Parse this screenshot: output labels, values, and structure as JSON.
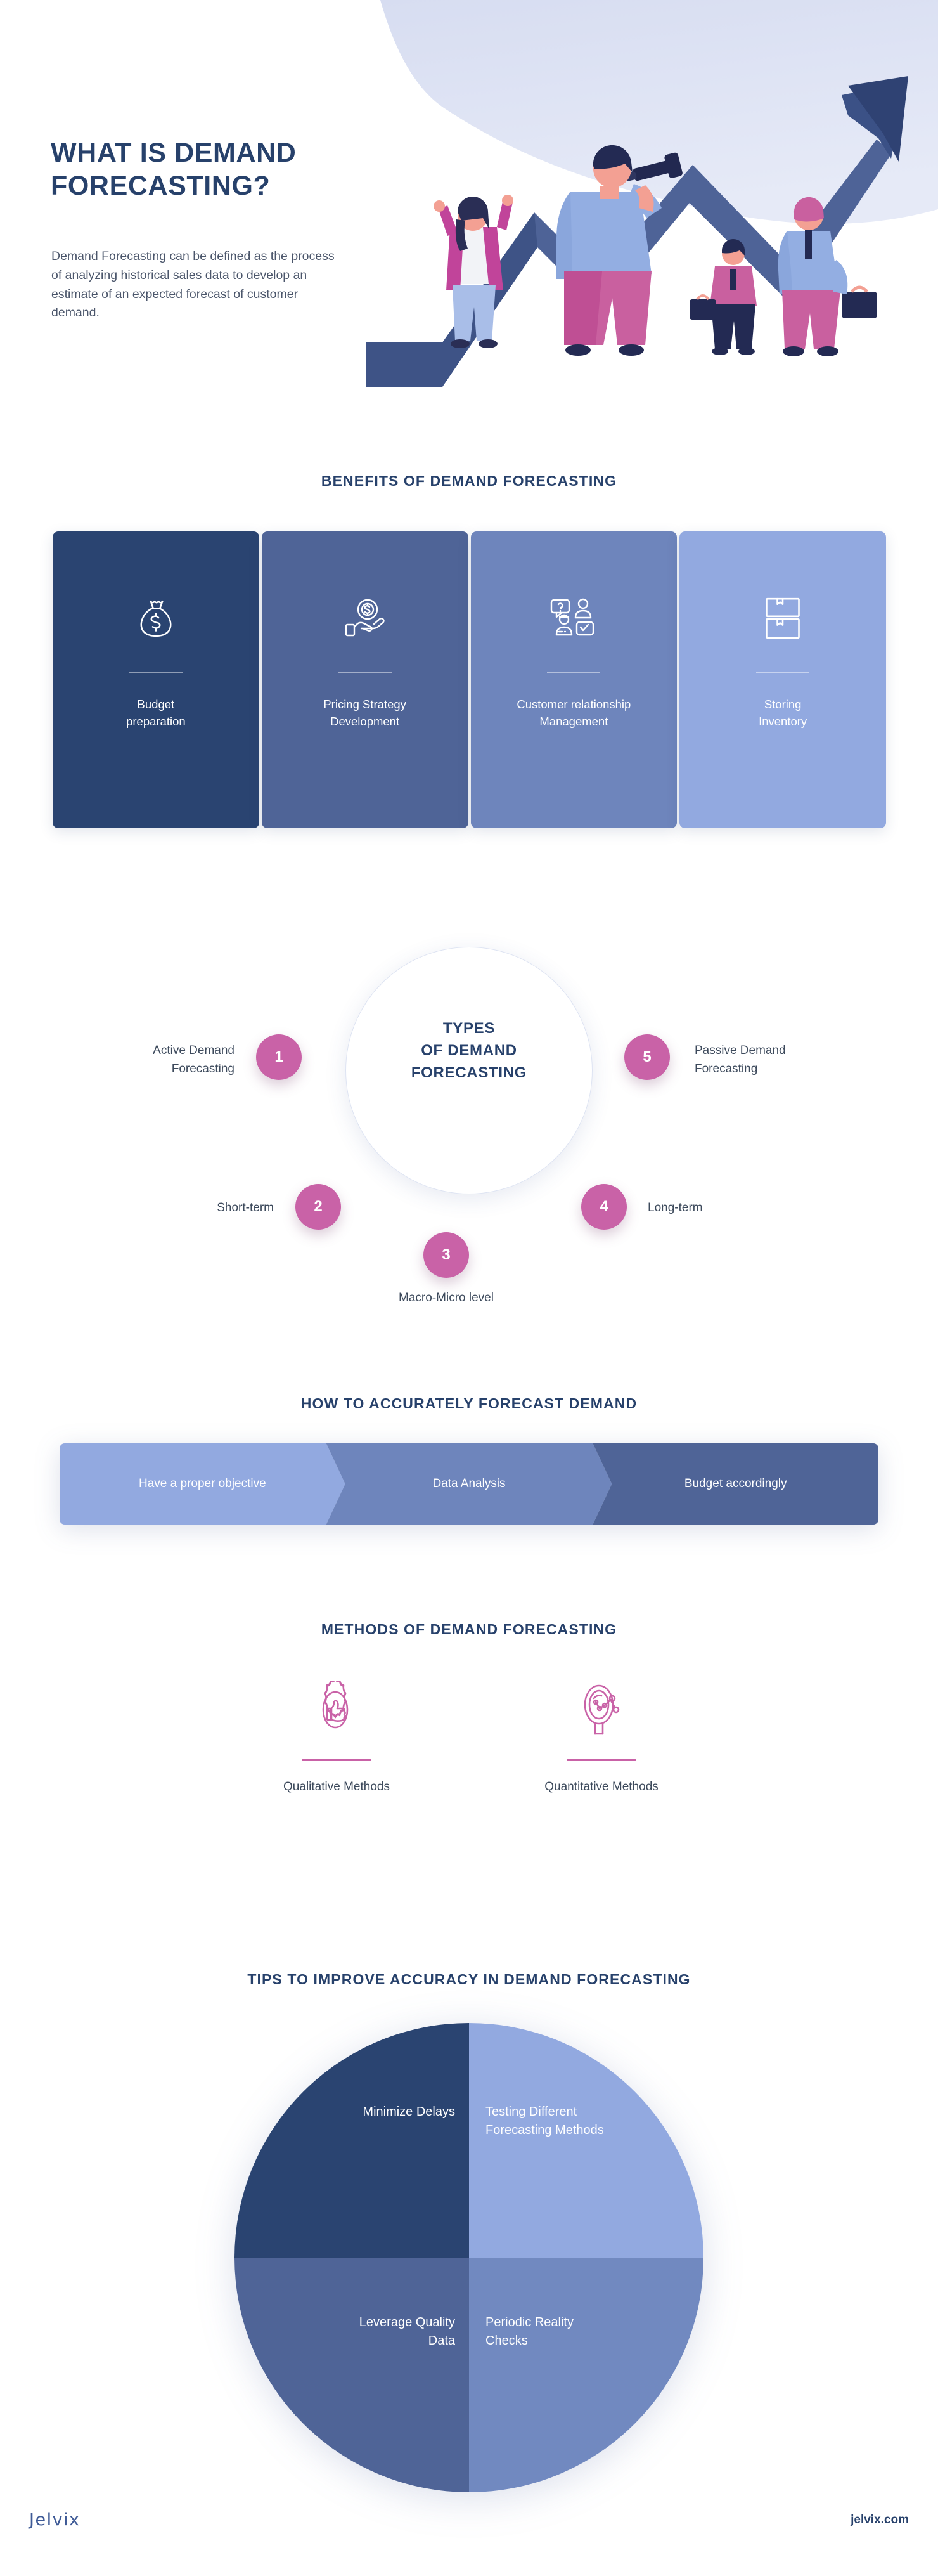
{
  "colors": {
    "navy": "#27416B",
    "navy_dark": "#2A4471",
    "slate": "#4F6497",
    "blue_mid": "#6E85BC",
    "blue_light": "#92A9E0",
    "pink": "#C962A7",
    "body_text": "#4B566B",
    "wave": "#DBE0F2"
  },
  "hero": {
    "title": "What is Demand Forecasting?",
    "description": "Demand Forecasting can be defined as the process of analyzing historical sales data to develop an estimate of an expected forecast of customer demand.",
    "illustration": "business-people-growth-arrow-telescope-illustration"
  },
  "benefits": {
    "heading": "Benefits of Demand Forecasting",
    "cards": [
      {
        "label": "Budget\npreparation",
        "icon": "money-bag-icon",
        "color": "#2A4471"
      },
      {
        "label": "Pricing Strategy\nDevelopment",
        "icon": "hand-holding-coin-icon",
        "color": "#4F6497"
      },
      {
        "label": "Customer relationship\nManagement",
        "icon": "customer-support-people-icon",
        "color": "#6E85BC"
      },
      {
        "label": "Storing\nInventory",
        "icon": "inventory-box-icon",
        "color": "#92A9E0"
      }
    ]
  },
  "types": {
    "center_title": "Types\nof Demand\nForecasting",
    "nodes": [
      {
        "number": "1",
        "label": "Active Demand\nForecasting"
      },
      {
        "number": "2",
        "label": "Short-term"
      },
      {
        "number": "3",
        "label": "Macro-Micro level"
      },
      {
        "number": "4",
        "label": "Long-term"
      },
      {
        "number": "5",
        "label": "Passive Demand\nForecasting"
      }
    ]
  },
  "process": {
    "heading": "How to Accurately Forecast Demand",
    "steps": [
      {
        "label": "Have a proper objective",
        "color": "#92A9E0"
      },
      {
        "label": "Data Analysis",
        "color": "#6E85BC"
      },
      {
        "label": "Budget accordingly",
        "color": "#4F6497"
      }
    ]
  },
  "methods": {
    "heading": "Methods of Demand Forecasting",
    "items": [
      {
        "label": "Qualitative Methods",
        "icon": "thumbs-up-badge-icon"
      },
      {
        "label": "Quantitative Methods",
        "icon": "magnifier-chart-icon"
      }
    ]
  },
  "tips": {
    "heading": "Tips to Improve Accuracy in Demand Forecasting",
    "chart_data": {
      "type": "pie",
      "title": "Tips to Improve Accuracy in Demand Forecasting",
      "categories": [
        "Minimize Delays",
        "Testing Different Forecasting Methods",
        "Leverage Quality Data",
        "Periodic Reality Checks"
      ],
      "values": [
        25,
        25,
        25,
        25
      ],
      "colors": [
        "#2A4471",
        "#92A9E0",
        "#4F6497",
        "#7189C0"
      ],
      "legend": "none",
      "labels_inside": true
    },
    "quadrants": [
      {
        "label": "Minimize Delays",
        "color": "#2A4471",
        "position": "top-left"
      },
      {
        "label": "Testing Different\nForecasting Methods",
        "color": "#92A9E0",
        "position": "top-right"
      },
      {
        "label": "Leverage Quality\nData",
        "color": "#4F6497",
        "position": "bottom-left"
      },
      {
        "label": "Periodic Reality\nChecks",
        "color": "#7189C0",
        "position": "bottom-right"
      }
    ]
  },
  "footer": {
    "logo": "Jelvix",
    "website": "jelvix.com"
  }
}
